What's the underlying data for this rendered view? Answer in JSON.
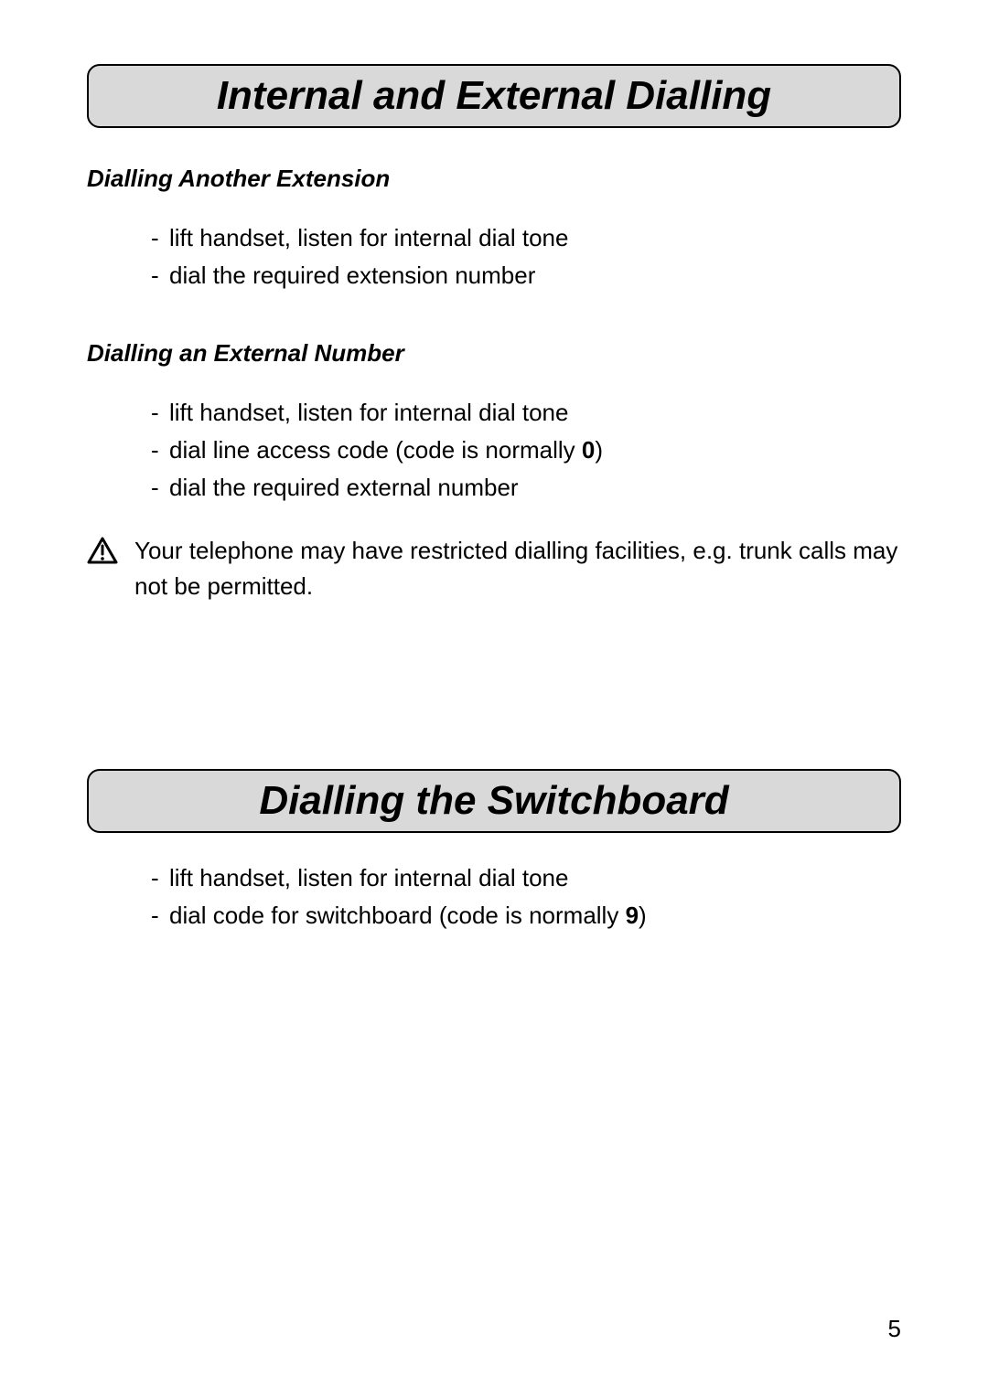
{
  "section1": {
    "title": "Internal and External Dialling",
    "sub1": {
      "heading": "Dialling Another Extension",
      "items": [
        "lift handset, listen for internal dial tone",
        "dial the required extension number"
      ]
    },
    "sub2": {
      "heading": "Dialling an External Number",
      "items": [
        "lift handset, listen for internal dial tone",
        "dial line access code (code is normally ",
        "dial the required external number"
      ],
      "bold_code": "0",
      "item2_suffix": ")"
    },
    "warning": "Your telephone may have restricted dialling facilities, e.g. trunk calls may not be permitted."
  },
  "section2": {
    "title": "Dialling the Switchboard",
    "items": [
      "lift handset, listen for internal dial tone",
      "dial code for switchboard (code is normally "
    ],
    "bold_code": "9",
    "item2_suffix": ")"
  },
  "page_number": "5"
}
